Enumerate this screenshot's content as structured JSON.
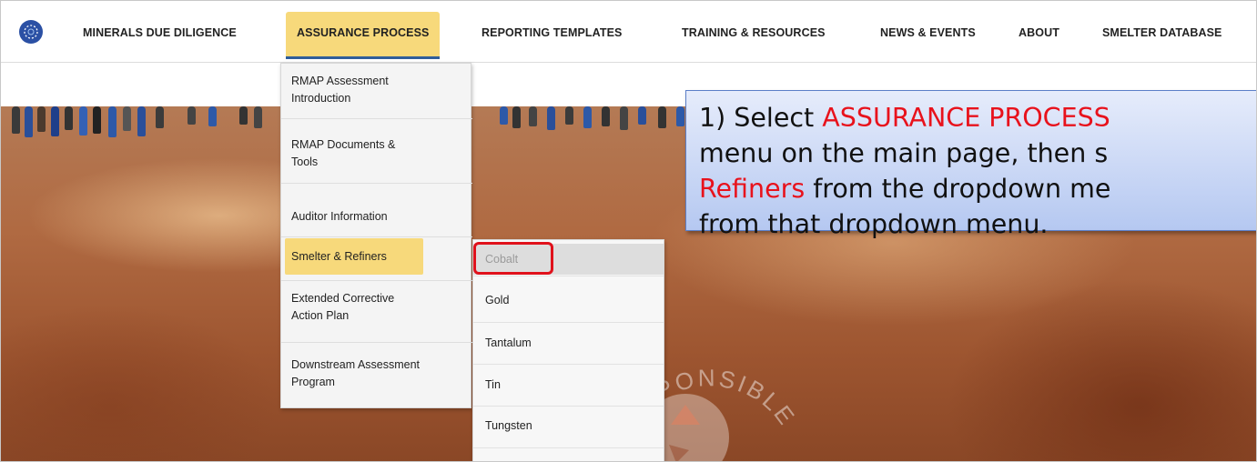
{
  "nav": {
    "items": [
      {
        "label": "MINERALS DUE DILIGENCE"
      },
      {
        "label": "ASSURANCE PROCESS",
        "active": true
      },
      {
        "label": "REPORTING TEMPLATES"
      },
      {
        "label": "TRAINING & RESOURCES"
      },
      {
        "label": "NEWS & EVENTS"
      },
      {
        "label": "ABOUT"
      },
      {
        "label": "SMELTER DATABASE"
      }
    ]
  },
  "dropdown": {
    "items": [
      {
        "line1": "RMAP Assessment",
        "line2": "Introduction"
      },
      {
        "line1": "RMAP Documents &",
        "line2": "Tools"
      },
      {
        "line1": "Auditor Information",
        "line2": ""
      },
      {
        "line1": "Smelter & Refiners",
        "line2": "",
        "selected": true
      },
      {
        "line1": "Extended Corrective",
        "line2": "Action Plan"
      },
      {
        "line1": "Downstream Assessment",
        "line2": "Program"
      }
    ]
  },
  "submenu": {
    "items": [
      {
        "label": "Cobalt",
        "selected": true
      },
      {
        "label": "Gold"
      },
      {
        "label": "Tantalum"
      },
      {
        "label": "Tin"
      },
      {
        "label": "Tungsten"
      }
    ]
  },
  "callout": {
    "line1_a": "1) Select ",
    "line1_b": "ASSURANCE PROCESS",
    "line2": "menu on the main page, then s",
    "line3_a": "Refiners",
    "line3_b": " from the dropdown me",
    "line4": "from that dropdown menu."
  },
  "watermark": {
    "text": "RESPONSIBLE"
  },
  "colors": {
    "accent_yellow": "#f7d97b",
    "nav_underline": "#2f5d9a",
    "highlight_red": "#e8121c",
    "logo_blue": "#2b50a4"
  }
}
